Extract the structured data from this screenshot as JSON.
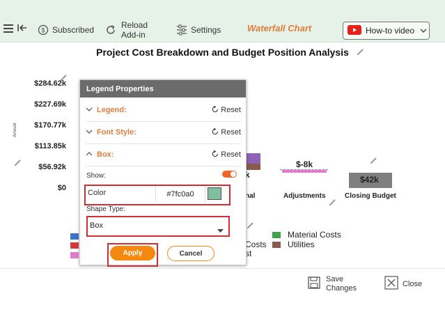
{
  "toolbar": {
    "subscribed_label": "Subscribed",
    "reload_label_line1": "Reload",
    "reload_label_line2": "Add-in",
    "settings_label": "Settings",
    "title": "Waterfall Chart",
    "howto_label": "How-to video"
  },
  "chart": {
    "title": "Project Cost Breakdown and Budget Position Analysis",
    "ylabel": "Amount",
    "data_labels": {
      "adjustments": "$-8k",
      "closing": "$42k",
      "partial": "k"
    },
    "legend": {
      "l1": "Material Costs",
      "l2": "Utilities",
      "partial1": "Costs",
      "partial2": "st"
    }
  },
  "chart_data": {
    "type": "bar",
    "title": "Project Cost Breakdown and Budget Position Analysis",
    "ylabel": "Amount",
    "y_ticks": [
      "$284.62k",
      "$227.69k",
      "$170.77k",
      "$113.85k",
      "$56.92k",
      "$0"
    ],
    "ylim": [
      0,
      284.62
    ],
    "categories": [
      "nal",
      "Adjustments",
      "Closing Budget"
    ],
    "bars": [
      {
        "category": "nal",
        "start": 50,
        "end": 95,
        "segments": [
          {
            "color": "#8e62b5",
            "from": 66,
            "to": 95
          },
          {
            "color": "#8a5a4c",
            "from": 50,
            "to": 66
          }
        ]
      },
      {
        "category": "Adjustments",
        "start": 42,
        "end": 50,
        "color": "#e47ad0",
        "label": "$-8k"
      },
      {
        "category": "Closing Budget",
        "start": 0,
        "end": 42,
        "color": "#7f7f7f",
        "label": "$42k"
      }
    ]
  },
  "dialog": {
    "title": "Legend Properties",
    "sections": [
      {
        "label": "Legend:",
        "reset": "Reset"
      },
      {
        "label": "Font Style:",
        "reset": "Reset"
      },
      {
        "label": "Box:",
        "reset": "Reset"
      }
    ],
    "show_label": "Show:",
    "color_label": "Color",
    "color_value": "#7fc0a0",
    "shape_label": "Shape Type:",
    "shape_value": "Box",
    "apply_label": "Apply",
    "cancel_label": "Cancel"
  },
  "footer": {
    "save_line1": "Save",
    "save_line2": "Changes",
    "close_label": "Close"
  },
  "colors": {
    "accent": "#e27d3a",
    "apply_bg": "#f5890f",
    "swatch": "#7fc0a0",
    "highlight": "#d52b35",
    "toggle": "#f26522",
    "header_bg": "#6b6b6b"
  }
}
